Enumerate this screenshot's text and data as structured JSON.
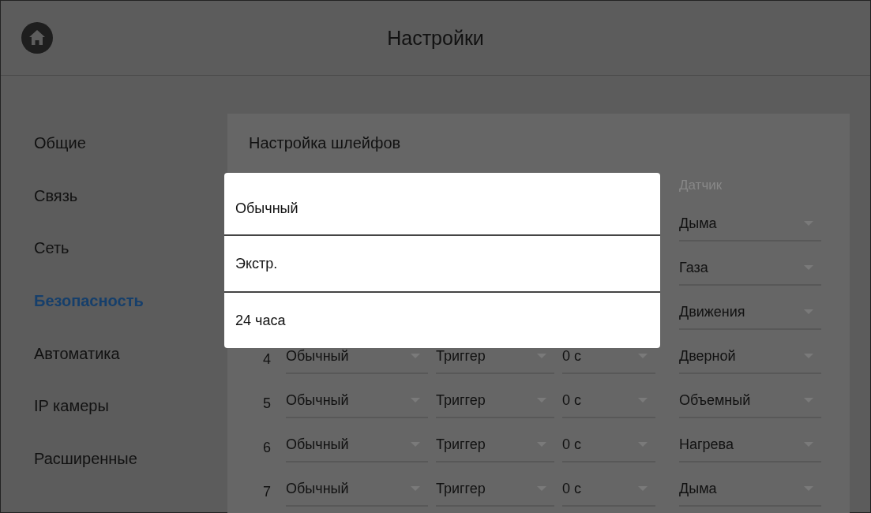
{
  "header": {
    "title": "Настройки"
  },
  "sidebar": {
    "items": [
      {
        "label": "Общие",
        "selected": false
      },
      {
        "label": "Связь",
        "selected": false
      },
      {
        "label": "Сеть",
        "selected": false
      },
      {
        "label": "Безопасность",
        "selected": true
      },
      {
        "label": "Автоматика",
        "selected": false
      },
      {
        "label": "IP камеры",
        "selected": false
      },
      {
        "label": "Расширенные",
        "selected": false
      }
    ]
  },
  "panel": {
    "title": "Настройка шлейфов",
    "sensor_column": "Датчик",
    "rows": [
      {
        "sensor": "Дыма"
      },
      {
        "sensor": "Газа"
      },
      {
        "sensor": "Движения"
      },
      {
        "number": "4",
        "type": "Обычный",
        "mode": "Триггер",
        "delay": "0 с",
        "sensor": "Дверной"
      },
      {
        "number": "5",
        "type": "Обычный",
        "mode": "Триггер",
        "delay": "0 с",
        "sensor": "Объемный"
      },
      {
        "number": "6",
        "type": "Обычный",
        "mode": "Триггер",
        "delay": "0 с",
        "sensor": "Нагрева"
      },
      {
        "number": "7",
        "type": "Обычный",
        "mode": "Триггер",
        "delay": "0 с",
        "sensor": "Дыма"
      }
    ]
  },
  "popup": {
    "options": [
      "Обычный",
      "Экстр.",
      "24 часа"
    ]
  }
}
